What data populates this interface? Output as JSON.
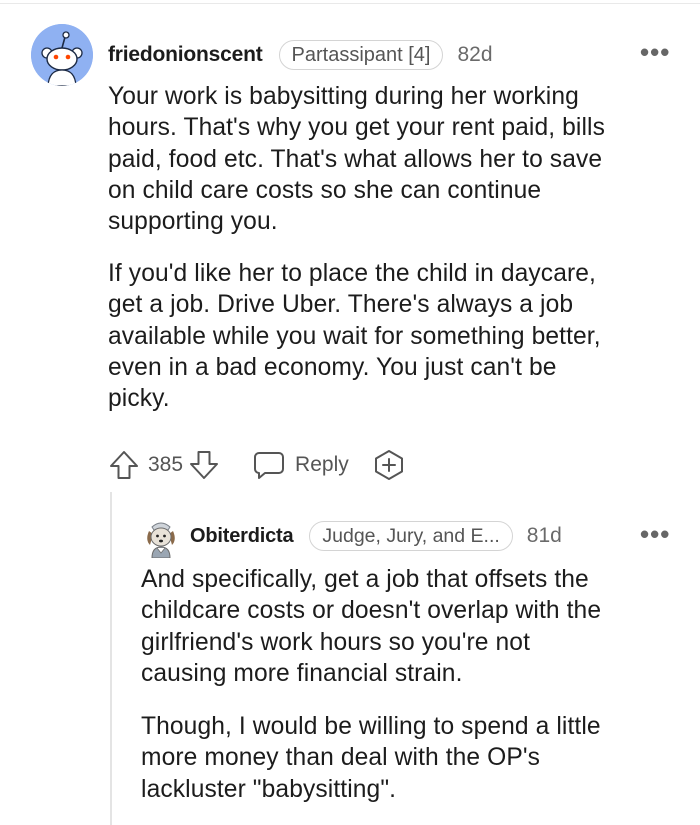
{
  "top_comment": {
    "username": "friedonionscent",
    "flair": "Partassipant [4]",
    "age": "82d",
    "paragraph1": [
      "Your work is babysitting during her working",
      "hours. That's why you get your rent paid, bills",
      "paid, food etc. That's what allows her to save",
      "on child care costs so she can continue",
      "supporting you."
    ],
    "paragraph2": [
      "If you'd like her to place the child in daycare,",
      "get a job. Drive Uber. There's always a job",
      "available while you wait for something better,",
      "even in a bad economy. You just can't be",
      "picky."
    ],
    "vote_count": "385",
    "reply_label": "Reply"
  },
  "reply_comment": {
    "username": "Obiterdicta",
    "flair": "Judge, Jury, and E...",
    "age": "81d",
    "paragraph1": [
      "And specifically, get a job that offsets the",
      "childcare costs or doesn't overlap with the",
      "girlfriend's work hours so you're not",
      "causing more financial strain."
    ],
    "paragraph2": [
      "Though, I would be willing to spend a little",
      "more money than deal with the OP's",
      "lackluster \"babysitting\"."
    ]
  },
  "colors": {
    "avatar_bg": "#8fb1f2",
    "text": "#1c1c1c",
    "muted": "#6a6a6a",
    "border": "#d4d4d4"
  },
  "icons": [
    "snoo-avatar-icon",
    "more-options-icon",
    "upvote-icon",
    "downvote-icon",
    "comment-bubble-icon",
    "award-plus-icon",
    "dog-avatar-icon"
  ]
}
